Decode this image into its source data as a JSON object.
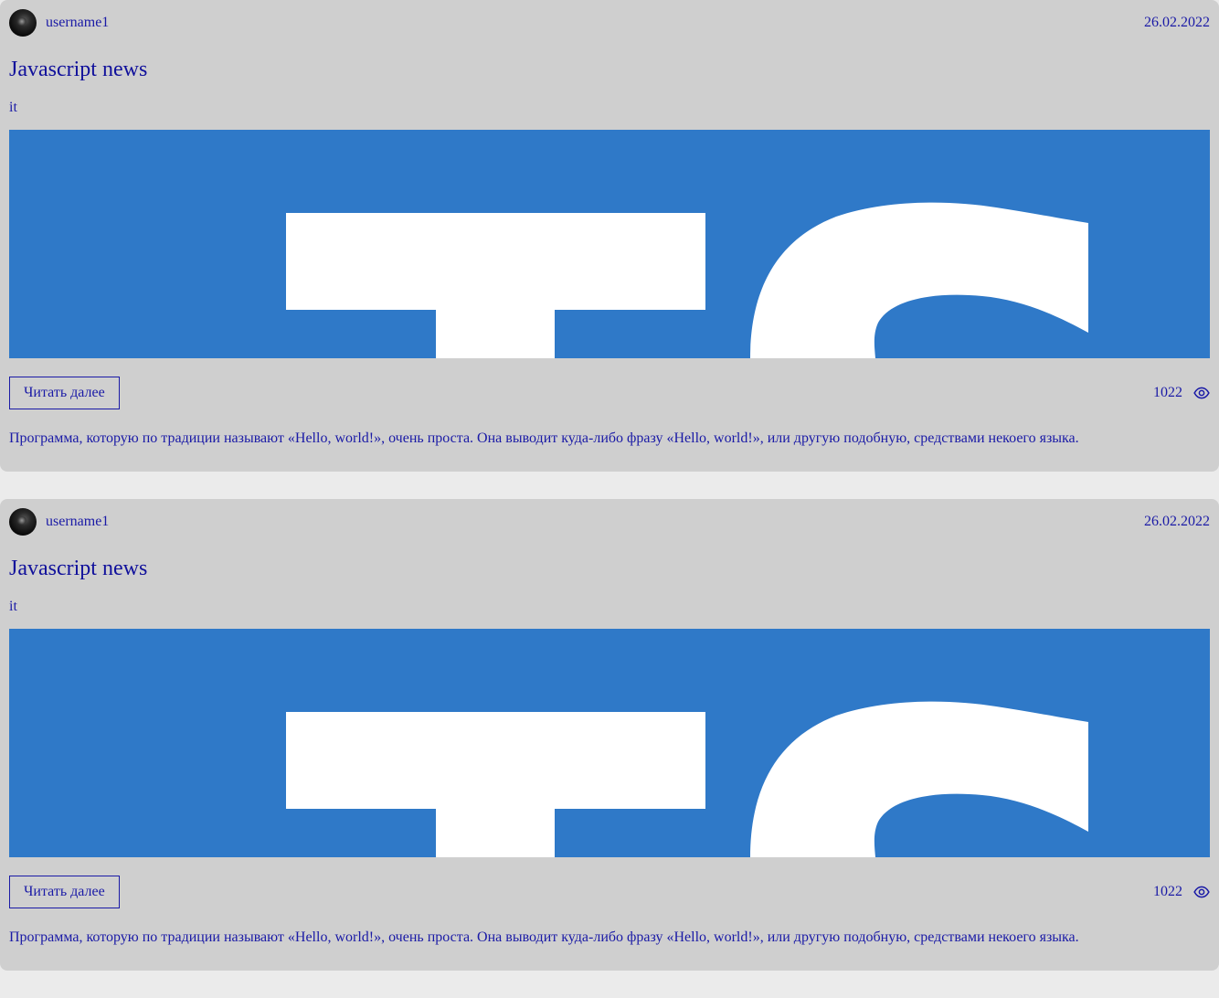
{
  "colors": {
    "page_background": "#ebebeb",
    "card_background": "#cfcfcf",
    "text_accent": "#1a1aa6",
    "image_background": "#2f79c8",
    "image_glyph": "#ffffff"
  },
  "posts": [
    {
      "author": "username1",
      "avatar_icon": "avatar-image",
      "date": "26.02.2022",
      "title": "Javascript news",
      "tag": "it",
      "image_label": "TS",
      "read_more_label": "Читать далее",
      "views": "1022",
      "views_icon": "eye-icon",
      "excerpt": "Программа, которую по традиции называют «Hello, world!», очень проста. Она выводит куда-либо фразу «Hello, world!», или другую подобную, средствами некоего языка."
    },
    {
      "author": "username1",
      "avatar_icon": "avatar-image",
      "date": "26.02.2022",
      "title": "Javascript news",
      "tag": "it",
      "image_label": "TS",
      "read_more_label": "Читать далее",
      "views": "1022",
      "views_icon": "eye-icon",
      "excerpt": "Программа, которую по традиции называют «Hello, world!», очень проста. Она выводит куда-либо фразу «Hello, world!», или другую подобную, средствами некоего языка."
    }
  ]
}
